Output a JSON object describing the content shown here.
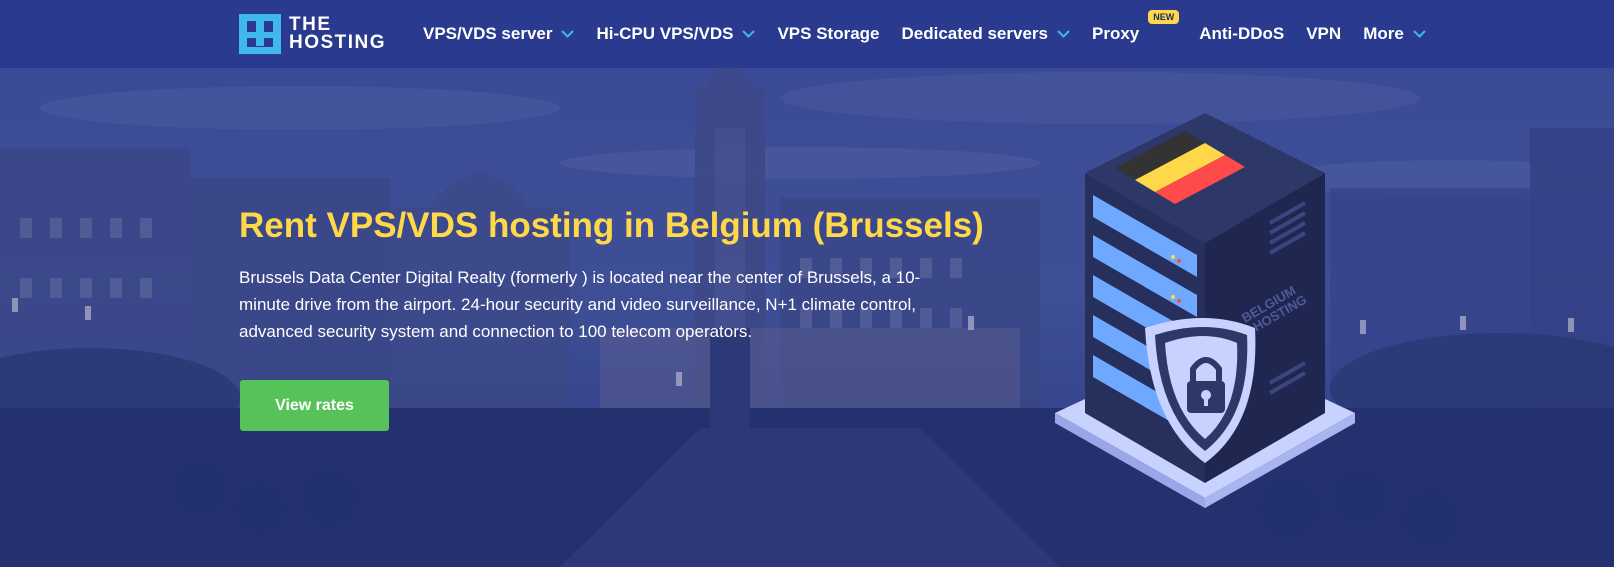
{
  "brand": {
    "line1": "THE",
    "line2": "HOSTING",
    "colors": {
      "mark": "#3fb8ee",
      "nav_bg": "#2a3b8f"
    }
  },
  "nav": {
    "items": [
      {
        "label": "VPS/VDS server",
        "dropdown": true
      },
      {
        "label": "Hi-CPU VPS/VDS",
        "dropdown": true
      },
      {
        "label": "VPS Storage",
        "dropdown": false
      },
      {
        "label": "Dedicated servers",
        "dropdown": true
      },
      {
        "label": "Proxy",
        "dropdown": false,
        "badge": "NEW"
      },
      {
        "label": "Anti-DDoS",
        "dropdown": false
      },
      {
        "label": "VPN",
        "dropdown": false
      },
      {
        "label": "More",
        "dropdown": true
      }
    ],
    "icons": {
      "dropdown": "chevron-down-icon"
    }
  },
  "hero": {
    "title": "Rent VPS/VDS hosting in Belgium (Brussels)",
    "description": "Brussels Data Center Digital Realty (formerly ) is located near the center of Brussels, a 10-minute drive from the airport. 24-hour security and video surveillance, N+1 climate control, advanced security system and connection to 100 telecom operators.",
    "cta_label": "View rates",
    "illustration_text": "BELGIUM\nPQ.HOSTING",
    "colors": {
      "title": "#ffd84a",
      "cta": "#58c25a"
    }
  }
}
